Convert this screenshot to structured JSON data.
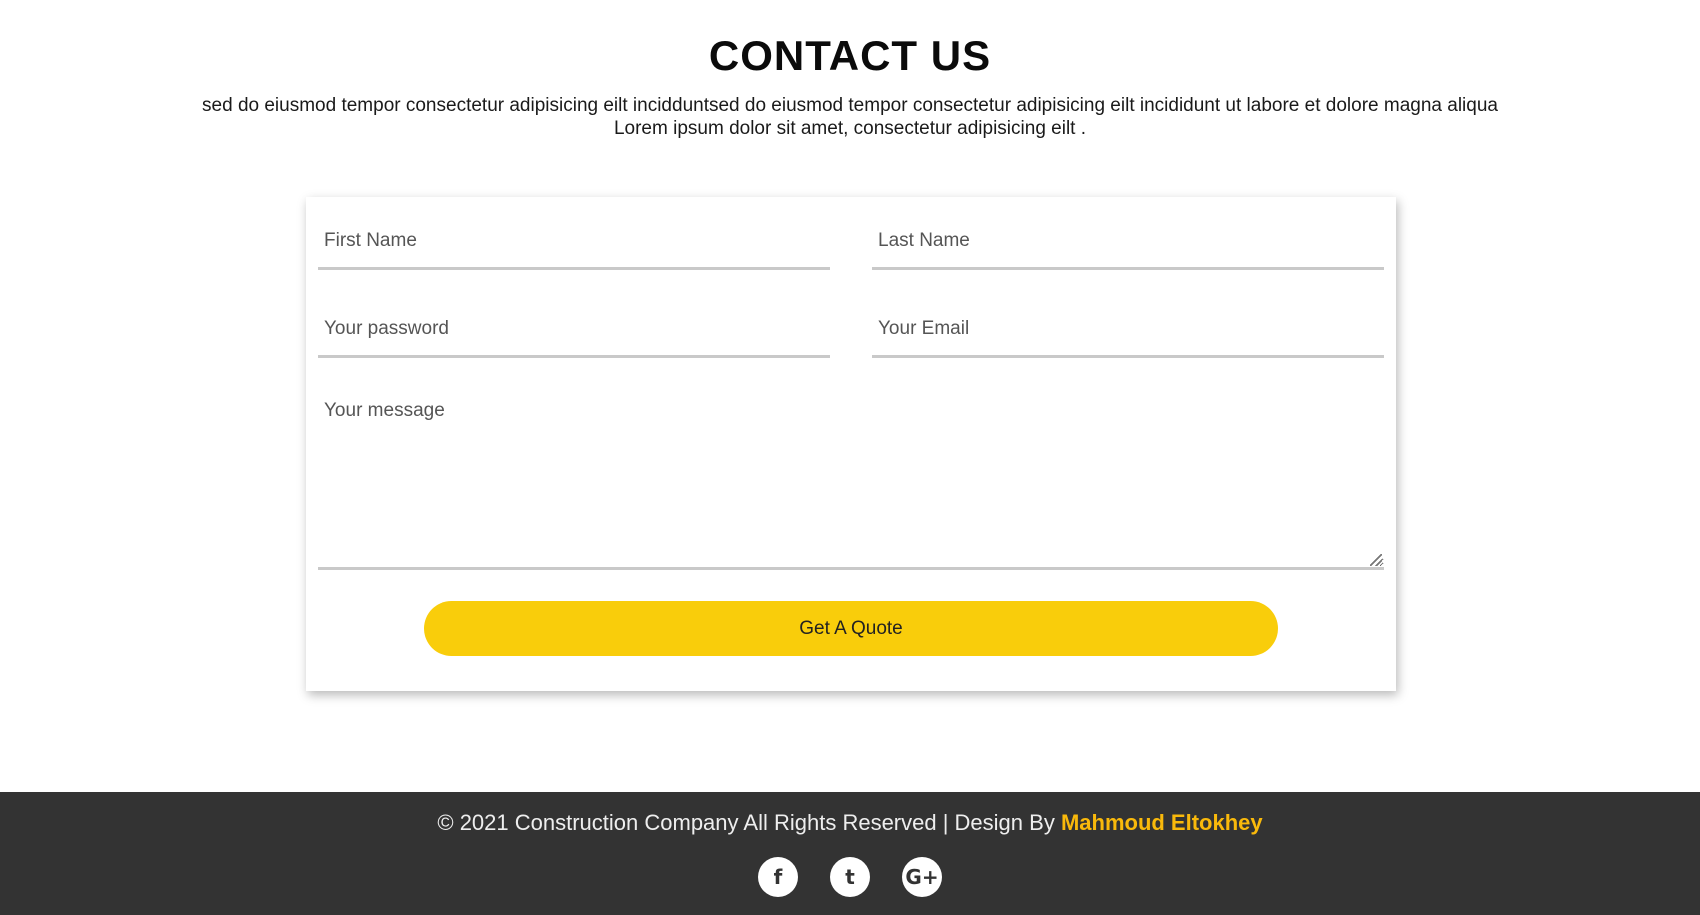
{
  "header": {
    "title": "CONTACT US",
    "subtitle_line1": "sed do eiusmod tempor consectetur adipisicing eilt incidduntsed do eiusmod tempor consectetur adipisicing eilt incididunt ut labore et dolore magna aliqua",
    "subtitle_line2": "Lorem ipsum dolor sit amet, consectetur adipisicing eilt ."
  },
  "form": {
    "first_name_placeholder": "First Name",
    "last_name_placeholder": "Last Name",
    "password_placeholder": "Your password",
    "email_placeholder": "Your Email",
    "message_placeholder": "Your message",
    "submit_label": "Get A Quote"
  },
  "footer": {
    "copyright": "© 2021 Construction Company All Rights Reserved | Design By ",
    "designer": "Mahmoud Eltokhey",
    "socials": [
      {
        "icon": "facebook-icon",
        "glyph": "f"
      },
      {
        "icon": "twitter-icon",
        "glyph": "t"
      },
      {
        "icon": "google-plus-icon",
        "glyph": "G+"
      }
    ]
  },
  "colors": {
    "accent": "#f9cd0b",
    "footer_bg": "#333333",
    "designer_text": "#f9b90b"
  }
}
